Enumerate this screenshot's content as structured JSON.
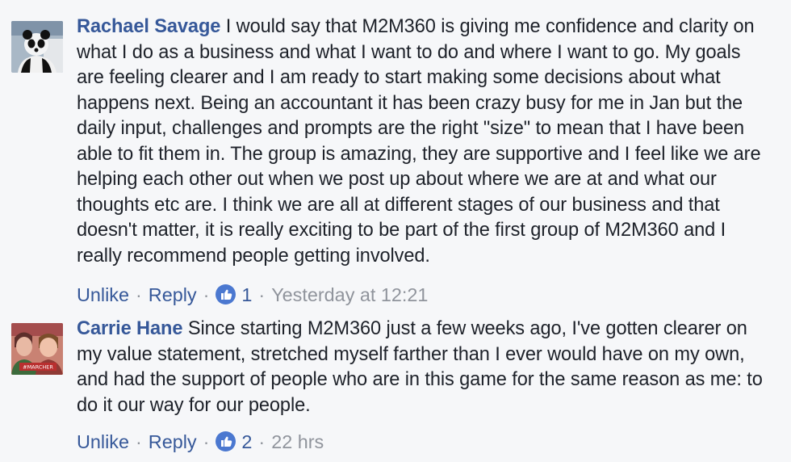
{
  "comments": [
    {
      "author": "Rachael Savage",
      "text": "I would say that M2M360 is giving me confidence and clarity on what I do as a business and what I want to do and where I want to go. My goals are feeling clearer and I am ready to start making some decisions about what happens next. Being an accountant it has been crazy busy for me in Jan but the daily input, challenges and prompts are the right \"size\" to mean that I have been able to fit them in. The group is amazing, they are supportive and I feel like we are helping each other out when we post up about where we are at and what our thoughts etc are. I think we are all at different stages of our business and that doesn't matter, it is really exciting to be part of the first group of M2M360 and I really recommend people getting involved.",
      "actions": {
        "unlike_label": "Unlike",
        "reply_label": "Reply",
        "separator": "·",
        "like_count": "1",
        "timestamp": "Yesterday at 12:21"
      },
      "avatar_icon": "panda-costume-avatar"
    },
    {
      "author": "Carrie Hane",
      "text": "Since starting M2M360 just a few weeks ago, I've gotten clearer on my value statement, stretched myself farther than I ever would have on my own, and had the support of people who are in this game for the same reason as me: to do it our way for our people.",
      "actions": {
        "unlike_label": "Unlike",
        "reply_label": "Reply",
        "separator": "·",
        "like_count": "2",
        "timestamp": "22 hrs"
      },
      "avatar_badge_text": "#MARCHER",
      "avatar_icon": "two-people-avatar"
    }
  ],
  "colors": {
    "background": "#f6f7f9",
    "author_link": "#365899",
    "body_text": "#1d2129",
    "meta_text": "#90949c",
    "like_badge": "#4b78d0"
  }
}
